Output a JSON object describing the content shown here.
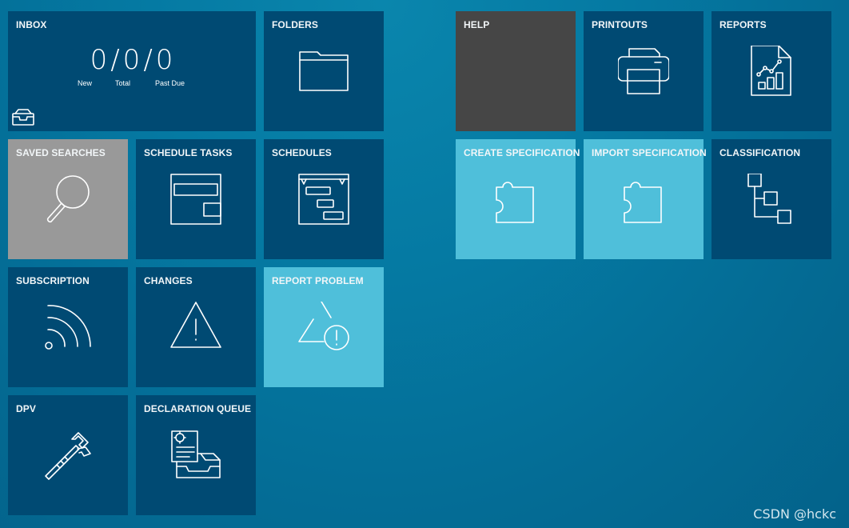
{
  "tiles": {
    "inbox": {
      "label": "INBOX",
      "counts": {
        "new": "0",
        "total": "0",
        "past_due": "0"
      },
      "count_labels": {
        "new": "New",
        "total": "Total",
        "past_due": "Past Due"
      },
      "separator": "/"
    },
    "folders": {
      "label": "FOLDERS",
      "icon": "folder-icon"
    },
    "help": {
      "label": "HELP"
    },
    "printouts": {
      "label": "PRINTOUTS",
      "icon": "printer-icon"
    },
    "reports": {
      "label": "REPORTS",
      "icon": "report-chart-icon"
    },
    "saved_searches": {
      "label": "SAVED SEARCHES",
      "icon": "magnifier-icon"
    },
    "schedule_tasks": {
      "label": "SCHEDULE TASKS",
      "icon": "schedule-task-icon"
    },
    "schedules": {
      "label": "SCHEDULES",
      "icon": "gantt-icon"
    },
    "create_specification": {
      "label": "CREATE SPECIFICATION",
      "icon": "puzzle-icon"
    },
    "import_specification": {
      "label": "IMPORT SPECIFICATION",
      "icon": "puzzle-icon"
    },
    "classification": {
      "label": "CLASSIFICATION",
      "icon": "hierarchy-icon"
    },
    "subscription": {
      "label": "SUBSCRIPTION",
      "icon": "rss-icon"
    },
    "changes": {
      "label": "CHANGES",
      "icon": "warning-triangle-icon"
    },
    "report_problem": {
      "label": "REPORT PROBLEM",
      "icon": "report-problem-icon"
    },
    "dpv": {
      "label": "DPV",
      "icon": "caliper-icon"
    },
    "declaration_queue": {
      "label": "DECLARATION QUEUE",
      "icon": "certificate-tray-icon"
    }
  },
  "colors": {
    "tile_dark_blue": "#004a73",
    "tile_light_blue": "#4fbfda",
    "tile_gray": "#999999",
    "tile_charcoal": "#464646",
    "background": "#057aa3"
  },
  "watermark": "CSDN @hckc"
}
